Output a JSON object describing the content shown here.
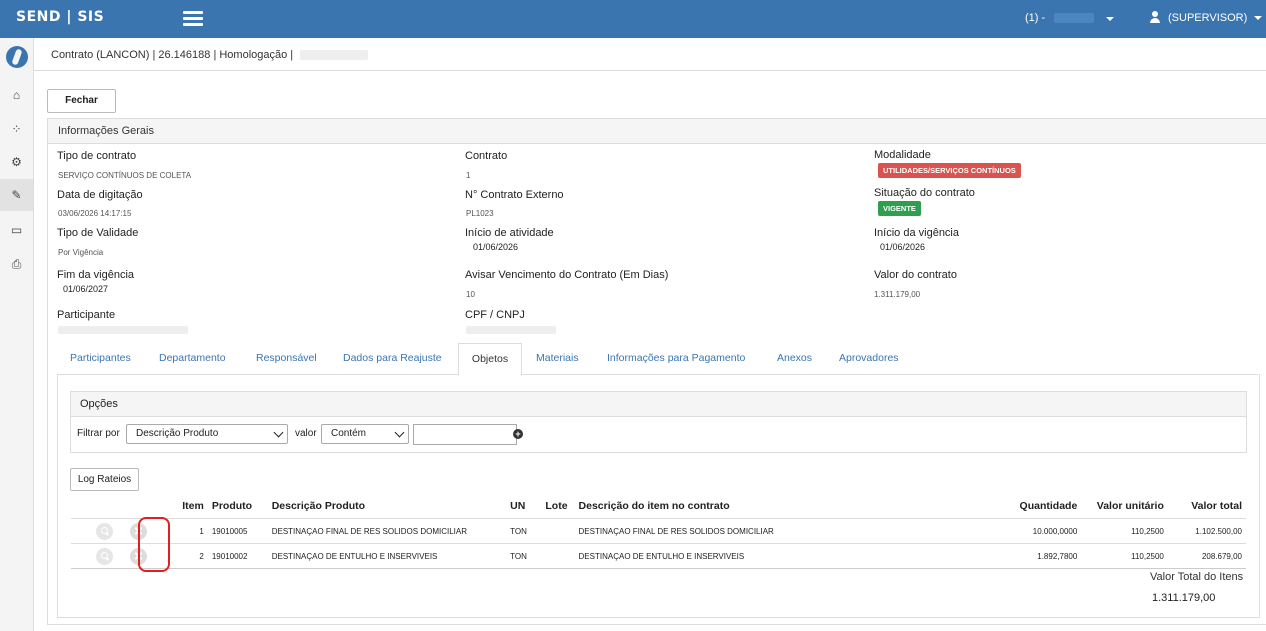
{
  "topbar": {
    "brand": "SEND | SIS",
    "selector_label": "(1) -",
    "user_label": "(SUPERVISOR)"
  },
  "sidebar": {
    "items": [
      {
        "icon": "home-icon",
        "glyph": "⌂"
      },
      {
        "icon": "spinner-icon",
        "glyph": "⁘"
      },
      {
        "icon": "cogs-icon",
        "glyph": "⚙"
      },
      {
        "icon": "edit-document-icon",
        "glyph": "✎"
      },
      {
        "icon": "laptop-icon",
        "glyph": "▭"
      },
      {
        "icon": "print-icon",
        "glyph": "⎙"
      }
    ]
  },
  "breadcrumb": {
    "text": "Contrato (LANCON) | 26.146188 | Homologação |"
  },
  "buttons": {
    "close": "Fechar",
    "log_rateios": "Log Rateios"
  },
  "panel": {
    "title": "Informações Gerais",
    "fields": {
      "tipo_contrato_label": "Tipo de contrato",
      "tipo_contrato_value": "SERVIÇO CONTÍNUOS DE COLETA",
      "contrato_label": "Contrato",
      "contrato_value": "1",
      "modalidade_label": "Modalidade",
      "modalidade_value": "UTILIDADES/SERVIÇOS CONTÍNUOS",
      "data_digitacao_label": "Data de digitação",
      "data_digitacao_value": "03/06/2026 14:17:15",
      "contrato_externo_label": "N° Contrato Externo",
      "contrato_externo_value": "PL1023",
      "situacao_label": "Situação do contrato",
      "situacao_value": "VIGENTE",
      "tipo_validade_label": "Tipo de Validade",
      "tipo_validade_value": "Por Vigência",
      "inicio_atividade_label": "Início de atividade",
      "inicio_atividade_value": "01/06/2026",
      "inicio_vigencia_label": "Início da vigência",
      "inicio_vigencia_value": "01/06/2026",
      "fim_vigencia_label": "Fim da vigência",
      "fim_vigencia_value": "01/06/2027",
      "avisar_label": "Avisar Vencimento do Contrato (Em Dias)",
      "avisar_value": "10",
      "valor_label": "Valor do contrato",
      "valor_value": "1.311.179,00",
      "participante_label": "Participante",
      "cpf_label": "CPF / CNPJ"
    },
    "colors": {
      "modalidade_badge": "#d9534f",
      "situacao_badge": "#2e9e4f"
    }
  },
  "tabs": [
    "Participantes",
    "Departamento",
    "Responsável",
    "Dados para Reajuste",
    "Objetos",
    "Materiais",
    "Informações para Pagamento",
    "Anexos",
    "Aprovadores"
  ],
  "active_tab": "Objetos",
  "options": {
    "title": "Opções",
    "filter_label": "Filtrar por",
    "filter_value": "Descrição Produto",
    "value_label": "valor",
    "operator_value": "Contém",
    "search_value": ""
  },
  "grid": {
    "headers": [
      "Item",
      "Produto",
      "Descrição Produto",
      "UN",
      "Lote",
      "Descrição do item no contrato",
      "Quantidade",
      "Valor unitário",
      "Valor total"
    ],
    "rows": [
      {
        "item": "1",
        "produto": "19010005",
        "descricao": "DESTINAÇAO FINAL DE RES SOLIDOS DOMICILIAR",
        "un": "TON",
        "lote": "",
        "descricao_contrato": "DESTINAÇAO FINAL DE RES SOLIDOS DOMICILIAR",
        "quantidade": "10.000,0000",
        "valor_unitario": "110,2500",
        "valor_total": "1.102.500,00"
      },
      {
        "item": "2",
        "produto": "19010002",
        "descricao": "DESTINAÇAO DE ENTULHO E INSERVIVEIS",
        "un": "TON",
        "lote": "",
        "descricao_contrato": "DESTINAÇAO DE ENTULHO E INSERVIVEIS",
        "quantidade": "1.892,7800",
        "valor_unitario": "110,2500",
        "valor_total": "208.679,00"
      }
    ],
    "total_label": "Valor Total do Itens",
    "total_value": "1.311.179,00"
  }
}
